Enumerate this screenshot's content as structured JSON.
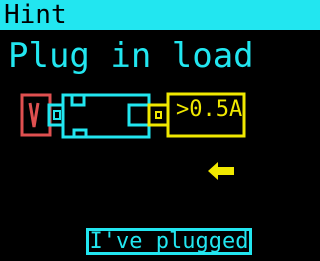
{
  "header": {
    "title": "Hint"
  },
  "main": {
    "message": "Plug in load",
    "load_label": ">0.5A",
    "button_label": "I've plugged"
  },
  "icons": {
    "power_source": "power-source-icon",
    "device": "device-icon",
    "load": "load-icon",
    "arrow": "arrow-left-icon"
  },
  "colors": {
    "accent": "#22E6F0",
    "load": "#F0E800",
    "source": "#E05050",
    "background": "#000000"
  }
}
